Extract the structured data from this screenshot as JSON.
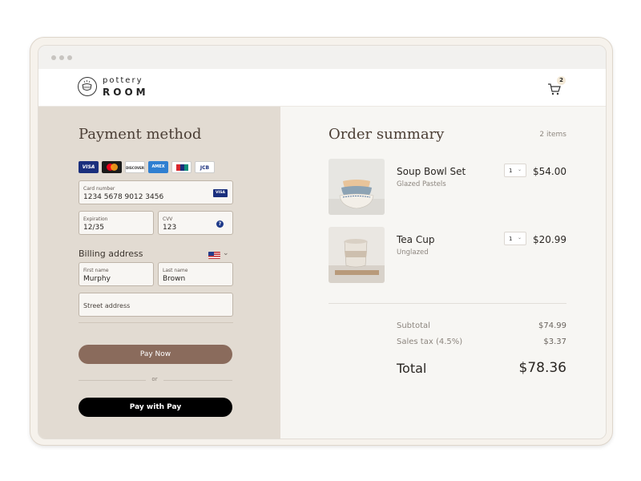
{
  "brand": {
    "name_top": "pottery",
    "name_bottom": "ROOM"
  },
  "cart": {
    "count": "2"
  },
  "payment": {
    "heading": "Payment method",
    "card_logos": [
      {
        "name": "VISA",
        "bg": "#1a2f7d",
        "fg": "#ffffff"
      },
      {
        "name": "",
        "bg": "#1b1b1b",
        "fg": "#ffffff"
      },
      {
        "name": "DISCOVER",
        "bg": "#ffffff",
        "fg": "#333333"
      },
      {
        "name": "AMEX",
        "bg": "#2f7fd1",
        "fg": "#ffffff"
      },
      {
        "name": "",
        "bg": "#ffffff",
        "fg": "#1a2f7d"
      },
      {
        "name": "JCB",
        "bg": "#ffffff",
        "fg": "#1a2f7d"
      }
    ],
    "card_number": {
      "label": "Card number",
      "value": "1234 5678 9012 3456",
      "brand": "VISA"
    },
    "expiration": {
      "label": "Expiration",
      "value": "12/35"
    },
    "cvv": {
      "label": "CVV",
      "value": "123"
    },
    "billing_label": "Billing address",
    "first_name": {
      "label": "First name",
      "value": "Murphy"
    },
    "last_name": {
      "label": "Last name",
      "value": "Brown"
    },
    "street": {
      "placeholder": "Street address"
    },
    "pay_now": "Pay Now",
    "or": "or",
    "apple_pay": "Pay with  Pay"
  },
  "summary": {
    "heading": "Order summary",
    "count": "2 items",
    "items": [
      {
        "name": "Soup Bowl Set",
        "variant": "Glazed Pastels",
        "qty": "1",
        "price": "$54.00"
      },
      {
        "name": "Tea Cup",
        "variant": "Unglazed",
        "qty": "1",
        "price": "$20.99"
      }
    ],
    "subtotal_label": "Subtotal",
    "subtotal": "$74.99",
    "tax_label": "Sales tax (4.5%)",
    "tax": "$3.37",
    "total_label": "Total",
    "total": "$78.36"
  },
  "colors": {
    "accent": "#8a6b5c",
    "panel": "#e2dbd2",
    "summary_bg": "#f7f6f3",
    "apple_pay_bg": "#000000"
  }
}
